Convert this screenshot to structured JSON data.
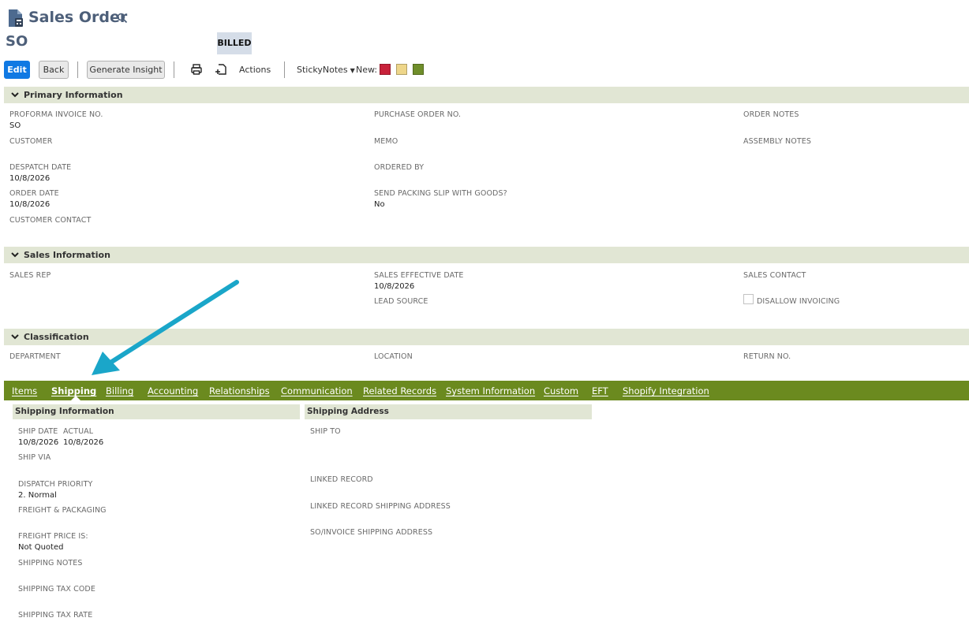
{
  "header": {
    "title": "Sales Order",
    "record_id": "SO",
    "status": "BILLED"
  },
  "toolbar": {
    "edit_label": "Edit",
    "back_label": "Back",
    "generate_label": "Generate Insight",
    "actions_label": "Actions",
    "stickynotes_label": "StickyNotes",
    "new_label": "New:",
    "note_colors": [
      "#c8223a",
      "#eed68a",
      "#6f8e2a"
    ]
  },
  "primary": {
    "title": "Primary Information",
    "proforma_label": "PROFORMA INVOICE NO.",
    "proforma_value": "SO",
    "customer_label": "CUSTOMER",
    "despatch_label": "DESPATCH DATE",
    "despatch_value": "10/8/2026",
    "order_date_label": "ORDER DATE",
    "order_date_value": "10/8/2026",
    "customer_contact_label": "CUSTOMER CONTACT",
    "po_label": "PURCHASE ORDER NO.",
    "memo_label": "MEMO",
    "ordered_by_label": "ORDERED BY",
    "send_packing_label": "SEND PACKING SLIP WITH GOODS?",
    "send_packing_value": "No",
    "order_notes_label": "ORDER NOTES",
    "assembly_notes_label": "ASSEMBLY NOTES"
  },
  "sales": {
    "title": "Sales Information",
    "sales_rep_label": "SALES REP",
    "effective_label": "SALES EFFECTIVE DATE",
    "effective_value": "10/8/2026",
    "lead_source_label": "LEAD SOURCE",
    "sales_contact_label": "SALES CONTACT",
    "disallow_label": "DISALLOW INVOICING"
  },
  "classification": {
    "title": "Classification",
    "department_label": "DEPARTMENT",
    "location_label": "LOCATION",
    "return_label": "RETURN NO."
  },
  "tabs": [
    {
      "label": "Items"
    },
    {
      "label": "Shipping"
    },
    {
      "label": "Billing"
    },
    {
      "label": "Accounting"
    },
    {
      "label": "Relationships"
    },
    {
      "label": "Communication"
    },
    {
      "label": "Related Records"
    },
    {
      "label": "System Information"
    },
    {
      "label": "Custom"
    },
    {
      "label": "EFT"
    },
    {
      "label": "Shopify Integration"
    }
  ],
  "shipping_info": {
    "title": "Shipping Information",
    "ship_date_label": "SHIP DATE",
    "ship_date_value": "10/8/2026",
    "actual_label": "ACTUAL",
    "actual_value": "10/8/2026",
    "ship_via_label": "SHIP VIA",
    "dispatch_priority_label": "DISPATCH PRIORITY",
    "dispatch_priority_value": "2. Normal",
    "freight_label": "FREIGHT & PACKAGING",
    "freight_price_label": "FREIGHT PRICE IS:",
    "freight_price_value": "Not Quoted",
    "shipping_notes_label": "SHIPPING NOTES",
    "shipping_tax_code_label": "SHIPPING TAX CODE",
    "shipping_tax_rate_label": "SHIPPING TAX RATE"
  },
  "shipping_address": {
    "title": "Shipping Address",
    "ship_to_label": "SHIP TO",
    "linked_record_label": "LINKED RECORD",
    "linked_shipping_label": "LINKED RECORD SHIPPING ADDRESS",
    "so_invoice_label": "SO/INVOICE SHIPPING ADDRESS"
  },
  "accent_color": "#6b8a1f"
}
